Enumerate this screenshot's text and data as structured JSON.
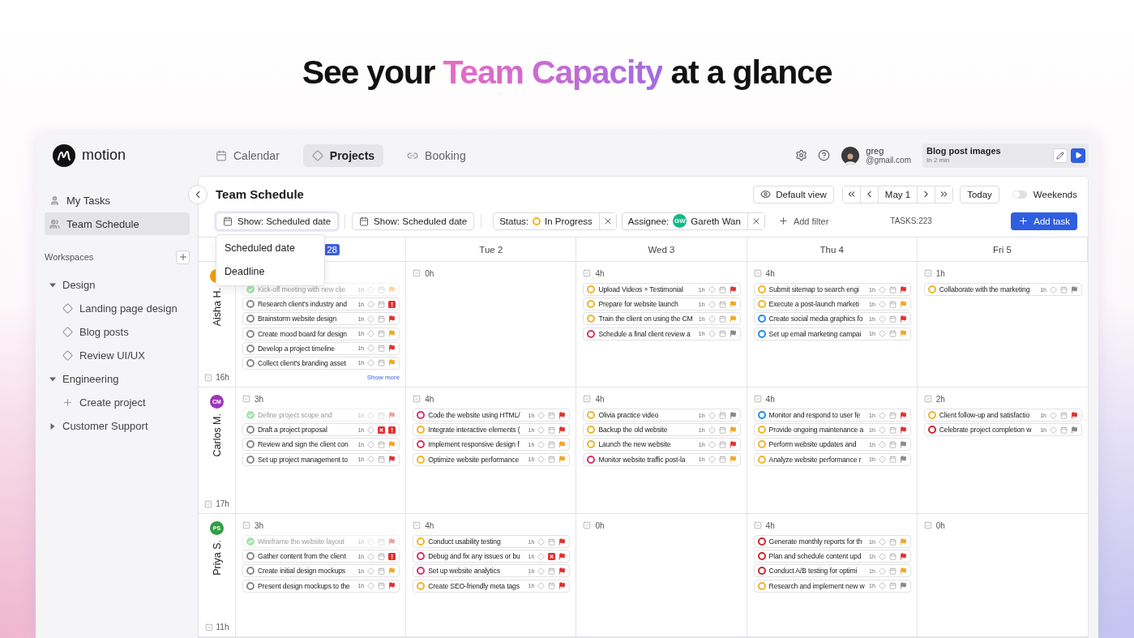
{
  "headline": {
    "before": "See your ",
    "highlight": "Team Capacity",
    "after": " at a glance"
  },
  "app": {
    "logo": "motion",
    "nav": [
      {
        "label": "Calendar",
        "selected": false
      },
      {
        "label": "Projects",
        "selected": true
      },
      {
        "label": "Booking",
        "selected": false
      }
    ],
    "user": {
      "name": "greg",
      "email": "@gmail.com"
    },
    "current_task": {
      "title": "Blog post images",
      "subtitle": "In 2 min"
    }
  },
  "sidebar": {
    "items": [
      {
        "label": "My Tasks",
        "selected": false
      },
      {
        "label": "Team Schedule",
        "selected": true
      }
    ],
    "section": "Workspaces",
    "tree": [
      {
        "label": "Design",
        "kind": "folder",
        "expanded": true,
        "children": [
          {
            "label": "Landing page design",
            "kind": "project"
          },
          {
            "label": "Blog posts",
            "kind": "project"
          },
          {
            "label": "Review UI/UX",
            "kind": "project"
          }
        ]
      },
      {
        "label": "Engineering",
        "kind": "folder",
        "expanded": true,
        "children": [
          {
            "label": "Create project",
            "kind": "action"
          }
        ]
      },
      {
        "label": "Customer Support",
        "kind": "folder",
        "expanded": false
      }
    ]
  },
  "schedule": {
    "title": "Team Schedule",
    "view": "Default view",
    "date": "May 1",
    "today": "Today",
    "weekends": {
      "label": "Weekends",
      "on": false
    },
    "filters": [
      {
        "kind": "show",
        "label": "Show: Scheduled date",
        "open": true,
        "options": [
          "Scheduled date",
          "Deadline"
        ]
      },
      {
        "kind": "show",
        "label": "Show: Scheduled date",
        "open": false
      },
      {
        "kind": "status",
        "label": "Status:",
        "value": "In Progress",
        "color": "#f0b429"
      },
      {
        "kind": "assignee",
        "label": "Assignee:",
        "initials": "GW",
        "value": "Gareth Wan",
        "color": "#12b886"
      },
      {
        "kind": "add",
        "label": "Add filter"
      }
    ],
    "count": "TASKS:223",
    "add_task": "Add task",
    "days": [
      {
        "badge": "28"
      },
      {
        "label": "Tue 2"
      },
      {
        "label": "Wed 3"
      },
      {
        "label": "Thu 4"
      },
      {
        "label": "Fri 5"
      }
    ],
    "rows": [
      {
        "name": "Aisha H.",
        "color": "#f59f00",
        "total": "16h",
        "days": [
          {
            "show_more": "Show more",
            "tasks": [
              {
                "title": "Kick-off meeting with new clie",
                "duration": "1h",
                "done": true,
                "overdue": false,
                "kind": "medium"
              },
              {
                "title": "Research client's industry and",
                "duration": "1h",
                "done": false,
                "color": "#8a8a8a",
                "overdue": false,
                "kind": "urgent"
              },
              {
                "title": "Brainstorm website design",
                "duration": "1h",
                "done": false,
                "color": "#8a8a8a",
                "overdue": false,
                "kind": "high"
              },
              {
                "title": "Create mood board for design",
                "duration": "1h",
                "done": false,
                "color": "#8a8a8a",
                "overdue": false,
                "kind": "medium"
              },
              {
                "title": "Develop a project timeline",
                "duration": "1h",
                "done": false,
                "color": "#8a8a8a",
                "overdue": false,
                "kind": "high"
              },
              {
                "title": "Collect client's branding asset",
                "duration": "1h",
                "done": false,
                "color": "#8a8a8a",
                "overdue": false,
                "kind": "medium"
              }
            ]
          },
          {
            "hours": "0h"
          },
          {
            "hours": "4h",
            "tasks": [
              {
                "title": "Upload Videos + Testimonial",
                "duration": "1h",
                "done": false,
                "color": "#f0b429",
                "overdue": false,
                "kind": "high"
              },
              {
                "title": "Prepare for website launch",
                "duration": "1h",
                "done": false,
                "color": "#f0b429",
                "overdue": false,
                "kind": "medium"
              },
              {
                "title": "Train the client on using the CM",
                "duration": "1h",
                "done": false,
                "color": "#f0b429",
                "overdue": false,
                "kind": "medium"
              },
              {
                "title": "Schedule a final client review a",
                "duration": "1h",
                "done": false,
                "color": "#d6336c",
                "overdue": false,
                "kind": "low"
              }
            ]
          },
          {
            "hours": "4h",
            "tasks": [
              {
                "title": "Submit sitemap to search engi",
                "duration": "1h",
                "done": false,
                "color": "#f0b429",
                "overdue": false,
                "kind": "high"
              },
              {
                "title": "Execute a post-launch marketi",
                "duration": "1h",
                "done": false,
                "color": "#f0b429",
                "overdue": false,
                "kind": "medium"
              },
              {
                "title": "Create social media graphics fo",
                "duration": "1h",
                "done": false,
                "color": "#228be6",
                "overdue": false,
                "kind": "high"
              },
              {
                "title": "Set up email marketing campai",
                "duration": "1h",
                "done": false,
                "color": "#228be6",
                "overdue": false,
                "kind": "medium"
              }
            ]
          },
          {
            "hours": "1h",
            "tasks": [
              {
                "title": "Collaborate with the marketing",
                "duration": "1h",
                "done": false,
                "color": "#f0b429",
                "overdue": false,
                "kind": "low"
              }
            ]
          }
        ]
      },
      {
        "name": "Carlos M.",
        "initials": "CM",
        "color": "#9c36b5",
        "total": "17h",
        "days": [
          {
            "hours": "3h",
            "tasks": [
              {
                "title": "Define project scope and",
                "duration": "1h",
                "done": true,
                "overdue": false,
                "kind": "high"
              },
              {
                "title": "Draft a project proposal",
                "duration": "1h",
                "done": false,
                "color": "#8a8a8a",
                "overdue": true,
                "kind": "urgent"
              },
              {
                "title": "Review and sign the client con",
                "duration": "1h",
                "done": false,
                "color": "#8a8a8a",
                "overdue": false,
                "kind": "medium"
              },
              {
                "title": "Set up project management to",
                "duration": "1h",
                "done": false,
                "color": "#8a8a8a",
                "overdue": false,
                "kind": "high"
              }
            ]
          },
          {
            "hours": "4h",
            "tasks": [
              {
                "title": "Code the website using HTML/",
                "duration": "1h",
                "done": false,
                "color": "#d6336c",
                "overdue": false,
                "kind": "high"
              },
              {
                "title": "Integrate interactive elements (",
                "duration": "1h",
                "done": false,
                "color": "#f0b429",
                "overdue": false,
                "kind": "high"
              },
              {
                "title": "Implement responsive design f",
                "duration": "1h",
                "done": false,
                "color": "#d6336c",
                "overdue": false,
                "kind": "medium"
              },
              {
                "title": "Optimize website performance",
                "duration": "1h",
                "done": false,
                "color": "#f0b429",
                "overdue": false,
                "kind": "medium"
              }
            ]
          },
          {
            "hours": "4h",
            "tasks": [
              {
                "title": "Olivia practice video",
                "duration": "1h",
                "done": false,
                "color": "#f0b429",
                "overdue": false,
                "kind": "low"
              },
              {
                "title": "Backup the old website",
                "duration": "1h",
                "done": false,
                "color": "#f0b429",
                "overdue": false,
                "kind": "medium"
              },
              {
                "title": "Launch the new website",
                "duration": "1h",
                "done": false,
                "color": "#f0b429",
                "overdue": false,
                "kind": "high"
              },
              {
                "title": "Monitor website traffic post-la",
                "duration": "1h",
                "done": false,
                "color": "#d6336c",
                "overdue": false,
                "kind": "medium"
              }
            ]
          },
          {
            "hours": "4h",
            "tasks": [
              {
                "title": "Monitor and respond to user fe",
                "duration": "1h",
                "done": false,
                "color": "#228be6",
                "overdue": false,
                "kind": "high"
              },
              {
                "title": "Provide ongoing maintenance a",
                "duration": "1h",
                "done": false,
                "color": "#f0b429",
                "overdue": false,
                "kind": "high"
              },
              {
                "title": "Perform website updates and",
                "duration": "1h",
                "done": false,
                "color": "#f0b429",
                "overdue": false,
                "kind": "low"
              },
              {
                "title": "Analyze website performance r",
                "duration": "1h",
                "done": false,
                "color": "#f0b429",
                "overdue": false,
                "kind": "low"
              }
            ]
          },
          {
            "hours": "2h",
            "tasks": [
              {
                "title": "Client follow-up and satisfactio",
                "duration": "1h",
                "done": false,
                "color": "#f0b429",
                "overdue": false,
                "kind": "high"
              },
              {
                "title": "Celebrate project completion w",
                "duration": "1h",
                "done": false,
                "color": "#c92a2a",
                "overdue": false,
                "kind": "low"
              }
            ]
          }
        ]
      },
      {
        "name": "Priya S.",
        "initials": "PS",
        "color": "#2f9e44",
        "total": "11h",
        "days": [
          {
            "hours": "3h",
            "tasks": [
              {
                "title": "Wireframe the website layout",
                "duration": "1h",
                "done": true,
                "overdue": false,
                "kind": "high"
              },
              {
                "title": "Gather content from the client",
                "duration": "1h",
                "done": false,
                "color": "#8a8a8a",
                "overdue": false,
                "kind": "urgent"
              },
              {
                "title": "Create initial design mockups",
                "duration": "1h",
                "done": false,
                "color": "#8a8a8a",
                "overdue": false,
                "kind": "medium"
              },
              {
                "title": "Present design mockups to the",
                "duration": "1h",
                "done": false,
                "color": "#8a8a8a",
                "overdue": false,
                "kind": "high"
              }
            ]
          },
          {
            "hours": "4h",
            "tasks": [
              {
                "title": "Conduct usability testing",
                "duration": "1h",
                "done": false,
                "color": "#f0b429",
                "overdue": false,
                "kind": "high"
              },
              {
                "title": "Debug and fix any issues or bu",
                "duration": "1h",
                "done": false,
                "color": "#d6336c",
                "overdue": true,
                "kind": "high"
              },
              {
                "title": "Set up website analytics",
                "duration": "1h",
                "done": false,
                "color": "#d6336c",
                "overdue": false,
                "kind": "high"
              },
              {
                "title": "Create SEO-friendly meta tags",
                "duration": "1h",
                "done": false,
                "color": "#f0b429",
                "overdue": false,
                "kind": "high"
              }
            ]
          },
          {
            "hours": "0h"
          },
          {
            "hours": "4h",
            "tasks": [
              {
                "title": "Generate monthly reports for th",
                "duration": "1h",
                "done": false,
                "color": "#c92a2a",
                "overdue": false,
                "kind": "medium"
              },
              {
                "title": "Plan and schedule content upd",
                "duration": "1h",
                "done": false,
                "color": "#c92a2a",
                "overdue": false,
                "kind": "high"
              },
              {
                "title": "Conduct A/B testing for optimi",
                "duration": "1h",
                "done": false,
                "color": "#c92a2a",
                "overdue": false,
                "kind": "medium"
              },
              {
                "title": "Research and implement new w",
                "duration": "1h",
                "done": false,
                "color": "#f0b429",
                "overdue": false,
                "kind": "low"
              }
            ]
          },
          {
            "hours": "0h"
          }
        ]
      }
    ]
  }
}
